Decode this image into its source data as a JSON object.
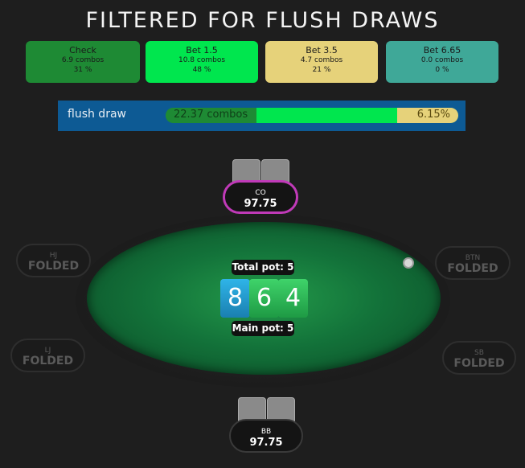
{
  "title": "FILTERED FOR FLUSH DRAWS",
  "actions": [
    {
      "name": "Check",
      "combos": "6.9 combos",
      "pct": "31 %",
      "color": "#1e8a34"
    },
    {
      "name": "Bet 1.5",
      "combos": "10.8 combos",
      "pct": "48 %",
      "color": "#00e64e"
    },
    {
      "name": "Bet 3.5",
      "combos": "4.7 combos",
      "pct": "21 %",
      "color": "#e6d27a"
    },
    {
      "name": "Bet 6.65",
      "combos": "0.0 combos",
      "pct": "0 %",
      "color": "#3fa898"
    }
  ],
  "filter": {
    "label": "flush draw",
    "combos": "22.37 combos",
    "pct": "6.15%",
    "bar_fractions": {
      "check": 0.31,
      "bet_1_5": 0.48,
      "bet_3_5": 0.21
    }
  },
  "board": {
    "total_pot": "Total pot: 5",
    "main_pot": "Main pot: 5",
    "cards": [
      "8",
      "6",
      "4"
    ],
    "card_colors": [
      "#2fb4e8",
      "#3fd36a",
      "#3fd36a"
    ]
  },
  "seats": {
    "co": {
      "name": "CO",
      "value": "97.75",
      "accent": "#c03ab8"
    },
    "bb": {
      "name": "BB",
      "value": "97.75"
    },
    "hj": {
      "name": "HJ",
      "value": "FOLDED"
    },
    "lj": {
      "name": "LJ",
      "value": "FOLDED"
    },
    "btn": {
      "name": "BTN",
      "value": "FOLDED"
    },
    "sb": {
      "name": "SB",
      "value": "FOLDED"
    }
  },
  "icons": {
    "dealer": "dealer-button-icon"
  }
}
